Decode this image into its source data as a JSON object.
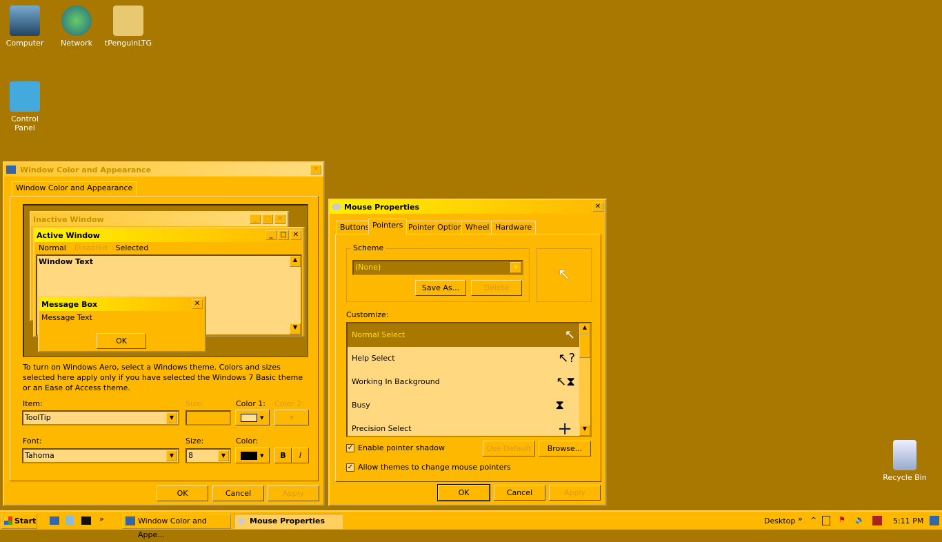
{
  "desktop": {
    "icons": [
      "Computer",
      "Network",
      "tPenguinLTG",
      "Control Panel",
      "Recycle Bin"
    ]
  },
  "wca": {
    "title": "Window Color and Appearance",
    "tab": "Window Color and Appearance",
    "preview": {
      "inactive": "Inactive Window",
      "active": "Active Window",
      "menu": [
        "Normal",
        "Disabled",
        "Selected"
      ],
      "window_text": "Window Text",
      "msgbox": "Message Box",
      "msg_text": "Message Text",
      "ok": "OK"
    },
    "info": "To turn on Windows Aero, select a Windows theme.  Colors and sizes selected here apply only if you have selected the Windows 7 Basic theme or an Ease of Access theme.",
    "item_label": "Item:",
    "item_value": "ToolTip",
    "size_label": "Size:",
    "color1_label": "Color 1:",
    "color2_label": "Color 2:",
    "font_label": "Font:",
    "font_value": "Tahoma",
    "fsize_label": "Size:",
    "fsize_value": "8",
    "fcolor_label": "Color:",
    "bold": "B",
    "italic": "I",
    "ok": "OK",
    "cancel": "Cancel",
    "apply": "Apply"
  },
  "mouse": {
    "title": "Mouse Properties",
    "tabs": [
      "Buttons",
      "Pointers",
      "Pointer Options",
      "Wheel",
      "Hardware"
    ],
    "scheme_label": "Scheme",
    "scheme_value": "(None)",
    "save_as": "Save As...",
    "delete": "Delete",
    "customize": "Customize:",
    "rows": [
      {
        "label": "Normal Select",
        "cursor": "↖"
      },
      {
        "label": "Help Select",
        "cursor": "↖?"
      },
      {
        "label": "Working In Background",
        "cursor": "↖⧗"
      },
      {
        "label": "Busy",
        "cursor": "⧗"
      },
      {
        "label": "Precision Select",
        "cursor": "+"
      }
    ],
    "shadow": "Enable pointer shadow",
    "themes": "Allow themes to change mouse pointers",
    "use_default": "Use Default",
    "browse": "Browse...",
    "ok": "OK",
    "cancel": "Cancel",
    "apply": "Apply"
  },
  "taskbar": {
    "start": "Start",
    "tasks": [
      "Window Color and Appe...",
      "Mouse Properties"
    ],
    "desktop": "Desktop",
    "clock": "5:11 PM"
  }
}
